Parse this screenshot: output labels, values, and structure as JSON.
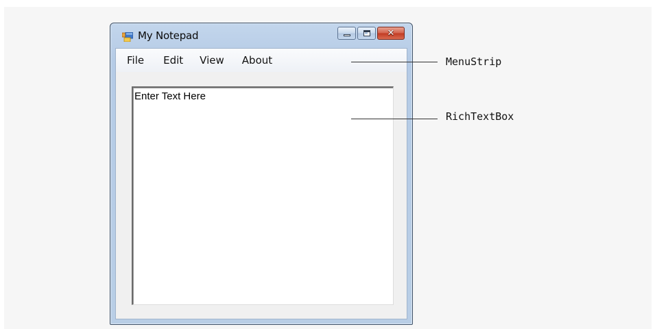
{
  "window": {
    "title": "My Notepad",
    "close_glyph": "✕"
  },
  "menu": {
    "items": [
      {
        "label": "File"
      },
      {
        "label": "Edit"
      },
      {
        "label": "View"
      },
      {
        "label": "About"
      }
    ]
  },
  "editor": {
    "value": "Enter Text Here"
  },
  "callouts": {
    "menustrip_label": "MenuStrip",
    "richtextbox_label": "RichTextBox"
  },
  "icons": {
    "app": "app-icon",
    "minimize": "minimize-icon",
    "maximize": "maximize-icon",
    "close": "close-icon"
  },
  "colors": {
    "window_frame": "#b9cee6",
    "close_button": "#c13a22",
    "client_bg": "#f0f0f0",
    "canvas_bg": "#f6f6f6"
  }
}
